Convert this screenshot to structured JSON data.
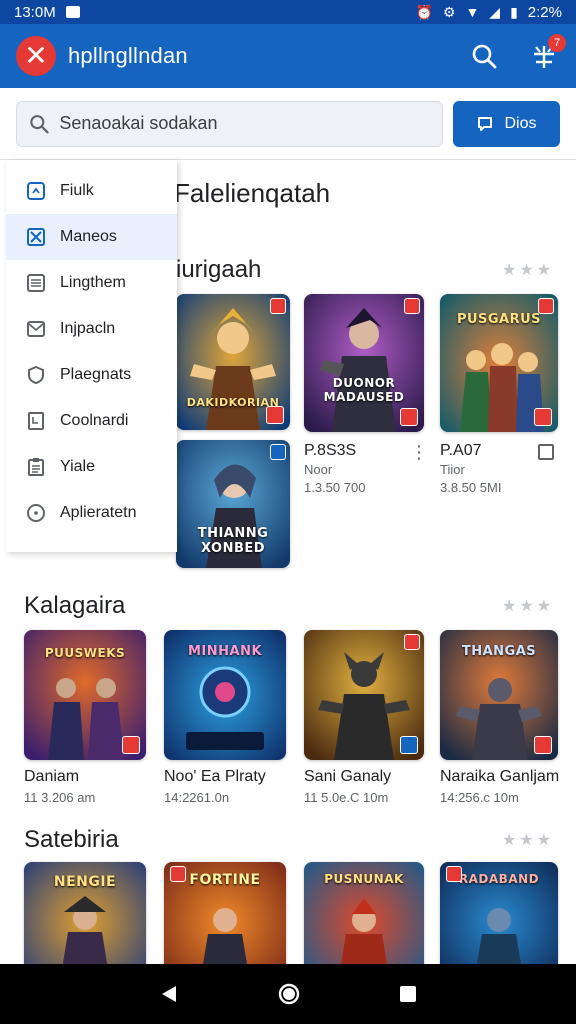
{
  "status_bar": {
    "time": "13:0M",
    "battery_time": "2:2%"
  },
  "app_bar": {
    "title": "hpllngllndan",
    "notification_count": "7"
  },
  "search": {
    "placeholder": "Senaoakai sodakan",
    "button_label": "Dios"
  },
  "drawer": {
    "items": [
      {
        "label": "Fiulk",
        "icon": "puzzle-icon"
      },
      {
        "label": "Maneos",
        "icon": "crossed-tools-icon",
        "active": true
      },
      {
        "label": "Lingthem",
        "icon": "list-icon"
      },
      {
        "label": "Injpacln",
        "icon": "envelope-icon"
      },
      {
        "label": "Plaegnats",
        "icon": "shield-icon"
      },
      {
        "label": "Coolnardi",
        "icon": "book-icon"
      },
      {
        "label": "Yiale",
        "icon": "clipboard-icon"
      },
      {
        "label": "Aplieratetn",
        "icon": "compass-icon"
      }
    ]
  },
  "main": {
    "heading": "Falelienqatah",
    "sections": [
      {
        "title": "iurigaah",
        "cards": [
          {
            "tile_text": "DAKIDKORIAN",
            "colors": [
              "#0b3a78",
              "#e0a63a"
            ]
          },
          {
            "tile_text": "DUONOR MADAUSED",
            "colors": [
              "#2b1b4a",
              "#b05cc6"
            ]
          },
          {
            "tile_text": "PUSGARUS",
            "colors": [
              "#0e5a6a",
              "#e0803a"
            ]
          },
          {
            "tile_text": "THIANNG XONBED",
            "colors": [
              "#123a6a",
              "#5aa7d6"
            ]
          }
        ],
        "info": [
          {
            "name": "P.8S3S",
            "sub": "Noor",
            "meta": "1.3.50 700"
          },
          {
            "name": "P.A07",
            "sub": "Tiior",
            "meta": "3.8.50 5MI"
          }
        ]
      },
      {
        "title": "Kalagaira",
        "cards": [
          {
            "name": "Daniam",
            "meta": "11 3.206 am",
            "tile_text": "PUUSWEKS",
            "colors": [
              "#3b1f6e",
              "#e06a2a"
            ]
          },
          {
            "name": "Noo' Ea Plraty",
            "meta": "14:2261.0n",
            "tile_text": "MINHANK",
            "colors": [
              "#0d2c66",
              "#2da0e0"
            ]
          },
          {
            "name": "Sani Ganaly",
            "meta": "11 5.0e.C 10m",
            "tile_text": "",
            "colors": [
              "#4a2a10",
              "#e0b040"
            ]
          },
          {
            "name": "Naraika Ganljam",
            "meta": "14:256.c 10m",
            "tile_text": "THANGAS",
            "colors": [
              "#1a2a44",
              "#e07a3a"
            ]
          }
        ]
      },
      {
        "title": "Satebiria",
        "cards": [
          {
            "tile_text": "NENGIE",
            "colors": [
              "#2a3f78",
              "#e0a030"
            ]
          },
          {
            "tile_text": "FORTINE",
            "colors": [
              "#7a2a18",
              "#f08a2a"
            ]
          },
          {
            "tile_text": "PUSNUNAK",
            "colors": [
              "#1e5a8a",
              "#e04a2a"
            ]
          },
          {
            "tile_text": "RADABAND",
            "colors": [
              "#0e2a56",
              "#2a8ad0"
            ]
          }
        ]
      }
    ]
  }
}
